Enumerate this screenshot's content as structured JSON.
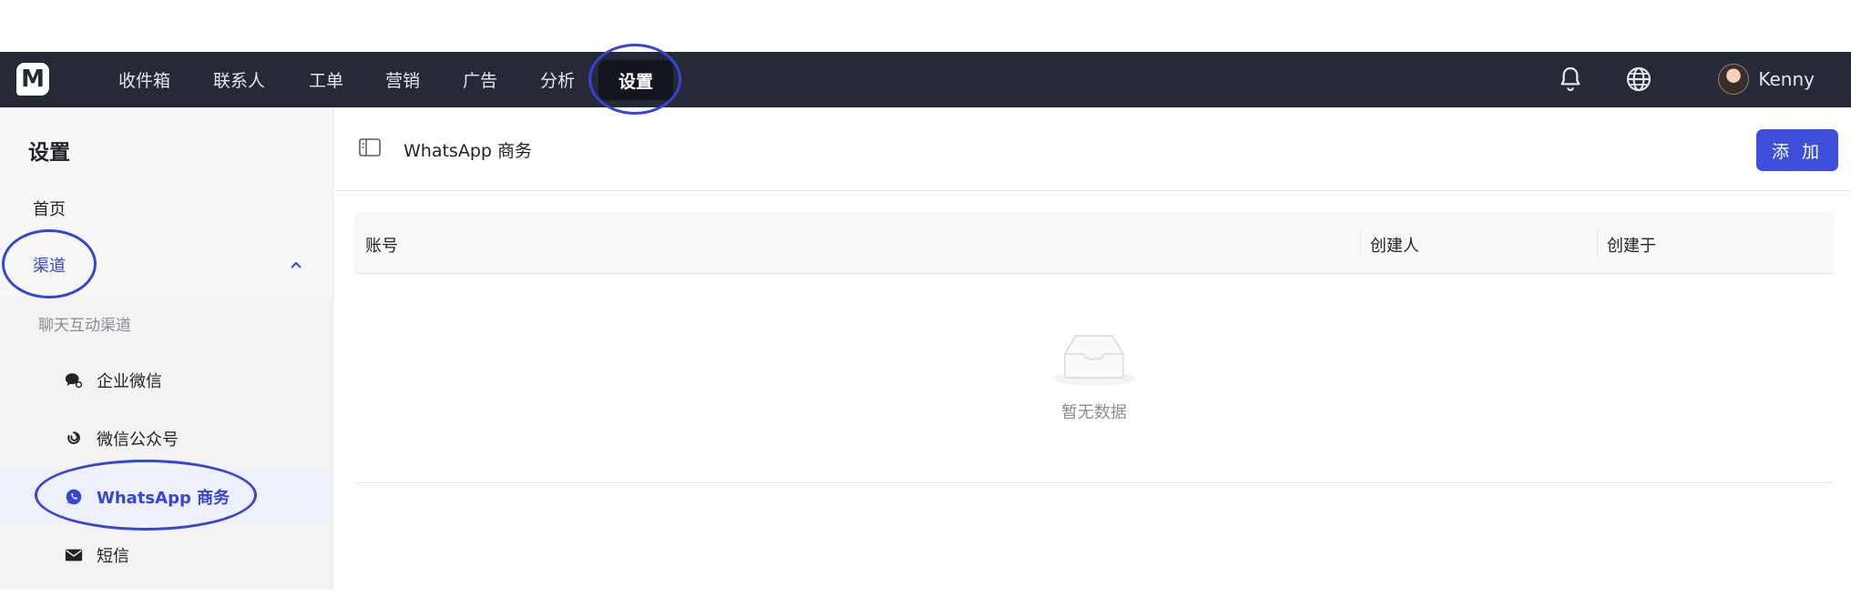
{
  "topnav": {
    "logo": "M",
    "items": [
      {
        "label": "收件箱"
      },
      {
        "label": "联系人"
      },
      {
        "label": "工单"
      },
      {
        "label": "营销"
      },
      {
        "label": "广告"
      },
      {
        "label": "分析"
      },
      {
        "label": "设置",
        "active": true
      }
    ],
    "icons": [
      "bell-icon",
      "globe-icon"
    ],
    "user_name": "Kenny"
  },
  "sidebar": {
    "title": "设置",
    "home_label": "首页",
    "channels_label": "渠道",
    "channels_expanded": true,
    "chat_channels_label": "聊天互动渠道",
    "channels": [
      {
        "label": "企业微信",
        "icon": "wechat-work-icon"
      },
      {
        "label": "微信公众号",
        "icon": "wechat-official-icon"
      },
      {
        "label": "WhatsApp 商务",
        "icon": "whatsapp-icon",
        "active": true
      },
      {
        "label": "短信",
        "icon": "mail-icon"
      }
    ]
  },
  "main": {
    "title": "WhatsApp 商务",
    "add_button": "添 加",
    "table": {
      "columns": [
        "账号",
        "创建人",
        "创建于"
      ],
      "rows": [],
      "empty_text": "暂无数据"
    }
  },
  "colors": {
    "accent": "#3d4fdb",
    "topbar": "#262a36",
    "annotation": "#3545d4"
  }
}
